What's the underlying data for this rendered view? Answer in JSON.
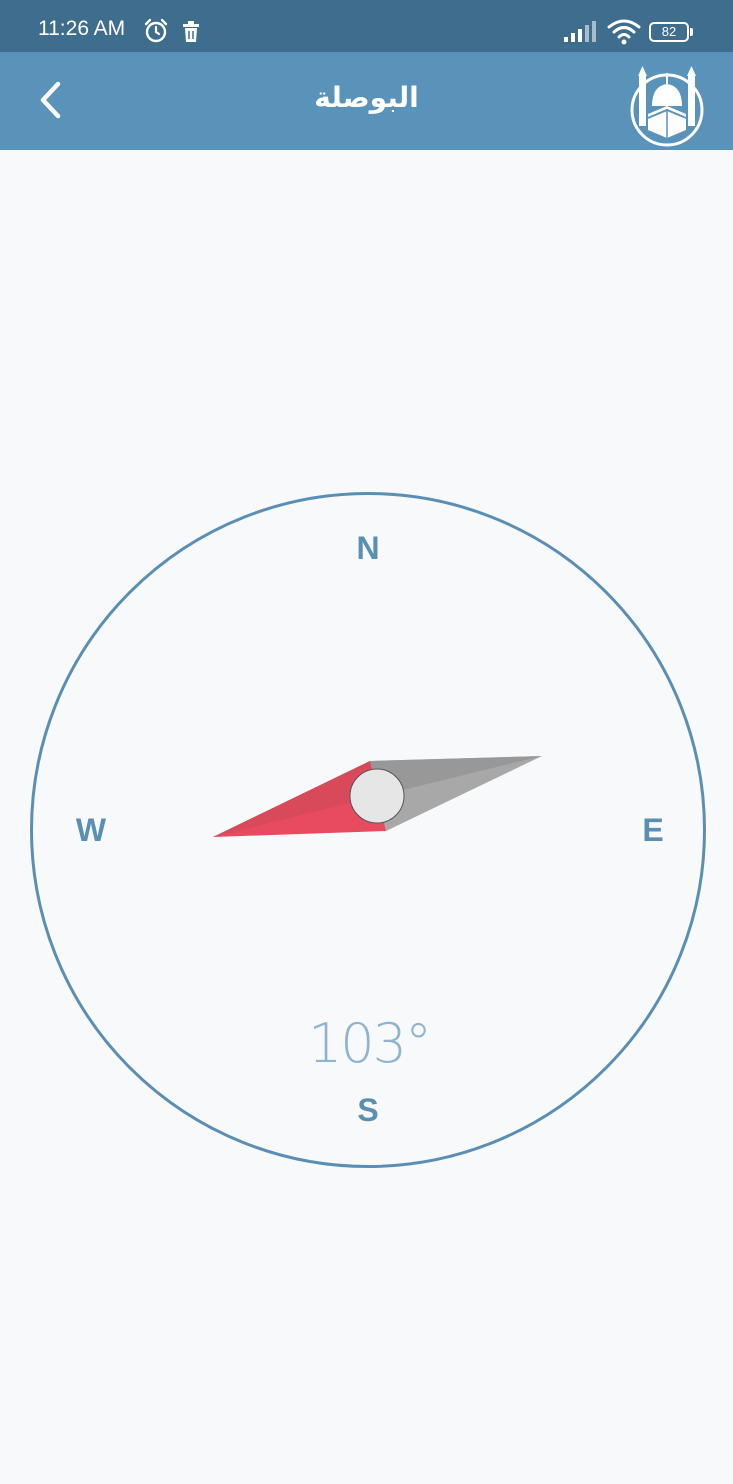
{
  "status_bar": {
    "time": "11:26 AM",
    "battery": "82",
    "icons": [
      "alarm-icon",
      "trash-icon",
      "signal-icon",
      "wifi-icon",
      "battery-icon"
    ]
  },
  "app_bar": {
    "title": "البوصلة",
    "back_icon": "chevron-left-icon",
    "logo_icon": "mosque-icon"
  },
  "compass": {
    "north": "N",
    "south": "S",
    "east": "E",
    "west": "W",
    "heading": "103°"
  },
  "colors": {
    "status_bar": "#3f6d8e",
    "app_bar": "#5a93ba",
    "ring": "#5a8fb5",
    "needle_north": "#e84a5f",
    "needle_south": "#a8a8a8",
    "degree_text": "#8fb4cf"
  }
}
